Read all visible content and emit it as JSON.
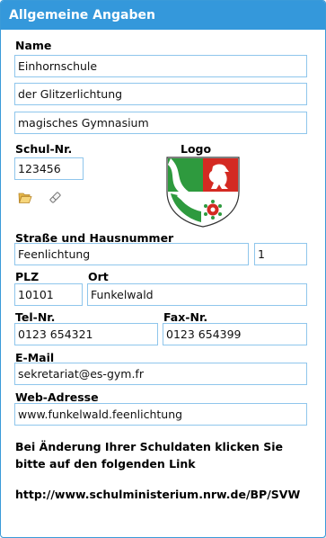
{
  "panel": {
    "title": "Allgemeine Angaben"
  },
  "name": {
    "label": "Name",
    "line1": "Einhornschule",
    "line2": "der Glitzerlichtung",
    "line3": "magisches Gymnasium"
  },
  "schulnr": {
    "label": "Schul-Nr.",
    "value": "123456"
  },
  "logo": {
    "label": "Logo"
  },
  "strasse": {
    "label": "Straße und Hausnummer",
    "street": "Feenlichtung",
    "number": "1"
  },
  "plz": {
    "label": "PLZ",
    "value": "10101"
  },
  "ort": {
    "label": "Ort",
    "value": "Funkelwald"
  },
  "tel": {
    "label": "Tel-Nr.",
    "value": "0123 654321"
  },
  "fax": {
    "label": "Fax-Nr.",
    "value": "0123 654399"
  },
  "email": {
    "label": "E-Mail",
    "value": "sekretariat@es-gym.fr"
  },
  "web": {
    "label": "Web-Adresse",
    "value": "www.funkelwald.feenlichtung"
  },
  "info": {
    "line1": "Bei Änderung Ihrer Schuldaten klicken Sie",
    "line2": "bitte auf den folgenden Link"
  },
  "link": {
    "text": "http://www.schulministerium.nrw.de/BP/SVW"
  },
  "icons": {
    "open": "folder-open-icon",
    "clear": "eraser-icon"
  },
  "colors": {
    "header": "#3498db",
    "field_border": "#8fc6ec",
    "logo_green": "#2e9a3e",
    "logo_red": "#d42a22"
  }
}
